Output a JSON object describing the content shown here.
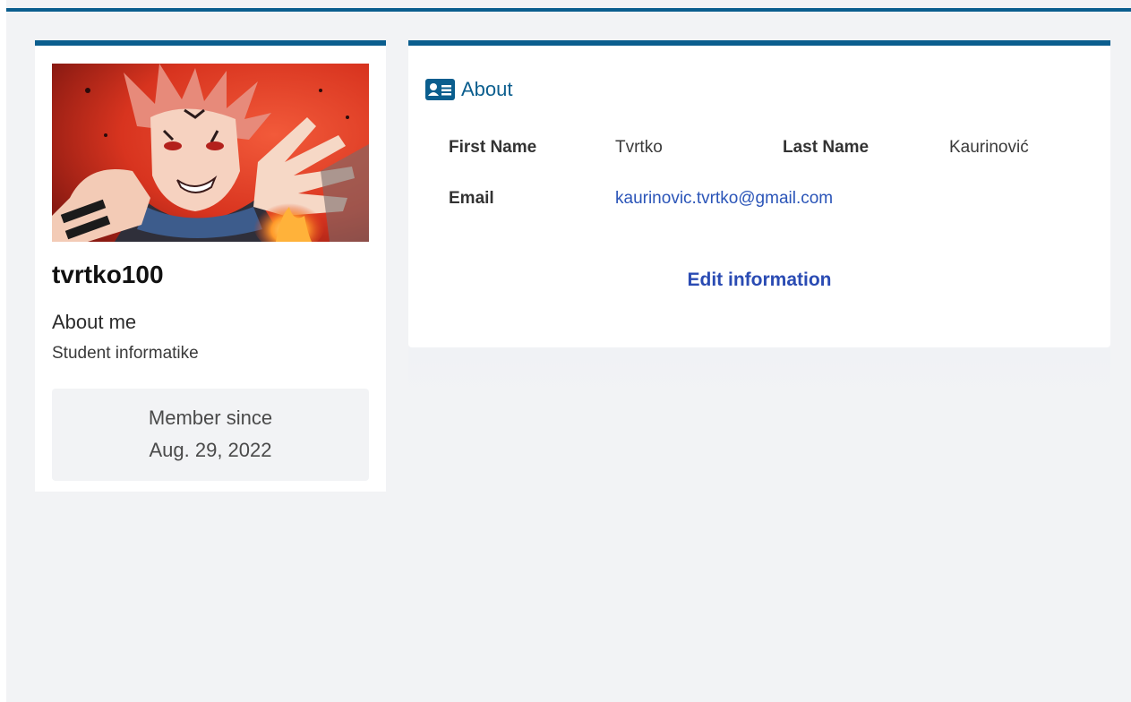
{
  "profile": {
    "username": "tvrtko100",
    "about_title": "About me",
    "about_text": "Student informatike",
    "member_since_label": "Member since",
    "member_since_date": "Aug. 29, 2022"
  },
  "about_card": {
    "title": "About",
    "icon": "id-card-icon",
    "fields": {
      "first_name_label": "First Name",
      "first_name_value": "Tvrtko",
      "last_name_label": "Last Name",
      "last_name_value": "Kaurinović",
      "email_label": "Email",
      "email_value": "kaurinovic.tvrtko@gmail.com"
    },
    "edit_label": "Edit information"
  },
  "colors": {
    "accent": "#0b5e8e",
    "link": "#2a4bb3",
    "background": "#f2f3f5"
  }
}
